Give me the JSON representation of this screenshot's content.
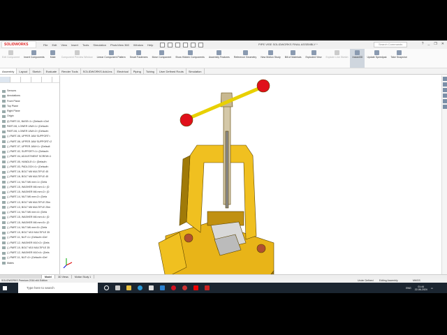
{
  "app": {
    "logo": "SOLIDWORKS",
    "title": "PIPE VISE SOLIDWORKS FINAL ASSEMBLY *",
    "search_placeholder": "Search Commands"
  },
  "menu": [
    "File",
    "Edit",
    "View",
    "Insert",
    "Tools",
    "Simulation",
    "PhotoView 360",
    "Window",
    "Help"
  ],
  "commands": [
    {
      "label": "Edit Component",
      "disabled": true
    },
    {
      "label": "Insert Components"
    },
    {
      "label": "Mate"
    },
    {
      "label": "Component Preview Window",
      "disabled": true
    },
    {
      "label": "Linear Component Pattern"
    },
    {
      "label": "Smart Fasteners"
    },
    {
      "label": "Move Component"
    },
    {
      "label": "Show Hidden Components"
    },
    {
      "label": "Assembly Features"
    },
    {
      "label": "Reference Geometry"
    },
    {
      "label": "New Motion Study"
    },
    {
      "label": "Bill of Materials"
    },
    {
      "label": "Exploded View"
    },
    {
      "label": "Explode Line Sketch",
      "disabled": true
    },
    {
      "label": "Instant3D",
      "active": true
    },
    {
      "label": "Update Speedpak"
    },
    {
      "label": "Take Snapshot"
    }
  ],
  "tabs": [
    "Assembly",
    "Layout",
    "Sketch",
    "Evaluate",
    "Render Tools",
    "SOLIDWORKS Add-Ins",
    "Electrical",
    "Piping",
    "Tubing",
    "User Defined Routs",
    "Simulation"
  ],
  "tree": [
    "Sensors",
    "Annotations",
    "Front Plane",
    "Top Plane",
    "Right Plane",
    "Origin",
    "(f) PART-01, BASE<1> (Default<<Def",
    "PART-06, LOWER JAW<1> (Default<",
    "PART-06, LOWER JAW<2> (Default<",
    "(-) PART-08, UPPER JAW SUPPORT<",
    "(-) PART-08, UPPER JAW SUPPORT<2",
    "(-) PART-07, UPPER JAW<1> (Default",
    "(-) PART-02, SUPPORT<1> (Default<",
    "(-) PART-04, ADJUSTMENT SCREW<1",
    "(-) PART-05, HANDLE<1> (Default<",
    "(-) PART-03, PADLOCK<1> (Default<",
    "(-) PART-16, BOLT M6 MULTIPLE 45",
    "(-) PART-16, BOLT M6 MULTIPLE 45",
    "(-) PART-14, NUT M6 mm<1> (Defa",
    "(-) PART-15, WASHER M6 mm<1> (D",
    "(-) PART-15, WASHER M6 mm<2> (D",
    "(-) PART-14, NUT M6 mm<2> (Defa",
    "(-) PART-13, BOLT M6 MULTIPLE 25m",
    "(-) PART-13, BOLT M6 MULTIPLE 25m",
    "(-) PART-14, NUT M6 mm<4> (Defa",
    "(-) PART-15, WASHER M6 mm<4> (D",
    "(-) PART-15, WASHER M6 mm<5> (D",
    "(-) PART-14, NUT M6 mm<5> (Defa",
    "(-) PART-10, BOLT M10 MULTIPLE 35",
    "(-) PART-11, NUT<1> (Default<<Def",
    "(-) PART-12, WASHER M10<2> (Defa",
    "(-) PART-10, BOLT M10 MULTIPLE 35",
    "(-) PART-12, WASHER M10<4> (Defa",
    "(-) PART-11, NUT<2> (Default<<Def",
    "Mates"
  ],
  "bottom_tabs": [
    "Model",
    "3D Views",
    "Motion Study 1"
  ],
  "status": {
    "edition": "SOLIDWORKS Premium 2016 x64 Edition",
    "state": "Under Defined",
    "mode": "Editing Assembly",
    "units": "MMGS"
  },
  "taskbar": {
    "search": "Type here to search",
    "lang": "ENG",
    "time": "01:44",
    "date": "22-06-2024"
  },
  "colors": {
    "part": "#e8b418",
    "handle_ball": "#e0101a",
    "accent": "#d22"
  }
}
